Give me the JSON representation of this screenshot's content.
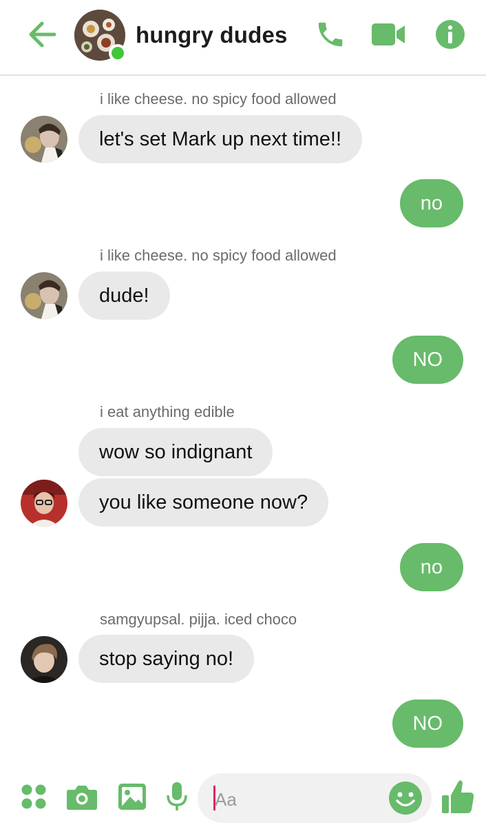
{
  "header": {
    "title": "hungry dudes",
    "back_icon": "arrow-left-icon",
    "call_icon": "phone-icon",
    "video_icon": "video-camera-icon",
    "info_icon": "info-icon"
  },
  "messages": [
    {
      "type": "label",
      "text": "i like cheese. no spicy food allowed"
    },
    {
      "type": "in",
      "text": "let's set Mark up next time!!"
    },
    {
      "type": "out",
      "text": "no"
    },
    {
      "type": "label",
      "text": "i like cheese. no spicy food allowed"
    },
    {
      "type": "in",
      "text": "dude!"
    },
    {
      "type": "out",
      "text": "NO"
    },
    {
      "type": "label",
      "text": "i eat anything edible"
    },
    {
      "type": "in",
      "text": "wow so indignant"
    },
    {
      "type": "in",
      "text": "you like someone now?"
    },
    {
      "type": "out",
      "text": "no"
    },
    {
      "type": "label",
      "text": "samgyupsal. pijja. iced choco"
    },
    {
      "type": "in",
      "text": "stop saying no!"
    },
    {
      "type": "out",
      "text": "NO"
    }
  ],
  "composer": {
    "placeholder": "Aa",
    "icons": [
      "apps-icon",
      "camera-icon",
      "gallery-icon",
      "microphone-icon",
      "emoji-icon",
      "thumbs-up-icon"
    ]
  },
  "colors": {
    "accent": "#67bb6a",
    "online": "#42c63a",
    "incoming_bubble": "#e9e9e9",
    "cursor": "#e0245e"
  }
}
